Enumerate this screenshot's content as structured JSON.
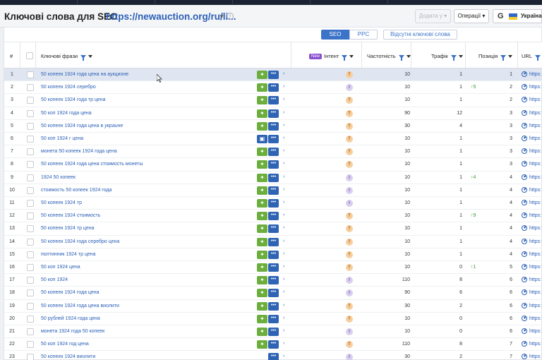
{
  "header": {
    "title": "Ключові слова для SEO",
    "domain": "https://newauction.org/ru/li...",
    "add_button": "Додати у",
    "operations_button": "Операції",
    "search_engine": "G",
    "country": "Україна"
  },
  "toggles": {
    "seo": "SEO",
    "ppc": "PPC",
    "missing": "Відсутні ключові слова"
  },
  "columns": {
    "num": "#",
    "keywords": "Ключові фрази",
    "intent_new": "New",
    "intent": "Інтент",
    "frequency": "Частотність",
    "traffic": "Трафік",
    "position": "Позиція",
    "url": "URL"
  },
  "colors": {
    "accent": "#3b73c8",
    "green_button": "#6cae3e",
    "blue_button": "#2f64b5",
    "intent_t": "#f6cfa0",
    "intent_i": "#d9cfee",
    "change_up": "#3c9a3c"
  },
  "rows": [
    {
      "num": "1",
      "kw": "50 копеек 1924 года цена на аукционе",
      "intent": "T",
      "freq": "10",
      "traffic": "1",
      "change": "",
      "pos": "1",
      "url": "https:"
    },
    {
      "num": "2",
      "kw": "50 копеек 1924 серебро",
      "intent": "I",
      "freq": "10",
      "traffic": "1",
      "change": "↑5",
      "pos": "2",
      "url": "https:"
    },
    {
      "num": "3",
      "kw": "50 копеек 1924 года тр цена",
      "intent": "T",
      "freq": "10",
      "traffic": "1",
      "change": "",
      "pos": "2",
      "url": "https:"
    },
    {
      "num": "4",
      "kw": "50 коп 1924 года цена",
      "intent": "T",
      "freq": "90",
      "traffic": "12",
      "change": "",
      "pos": "3",
      "url": "https:"
    },
    {
      "num": "5",
      "kw": "50 копеек 1924 года цена в украине",
      "intent": "T",
      "freq": "30",
      "traffic": "4",
      "change": "",
      "pos": "3",
      "url": "https:"
    },
    {
      "num": "6",
      "kw": "50 коп 1924 г цена",
      "intent": "T",
      "freq": "10",
      "traffic": "1",
      "change": "",
      "pos": "3",
      "url": "https:"
    },
    {
      "num": "7",
      "kw": "монета 50 копеек 1924 года цена",
      "intent": "T",
      "freq": "10",
      "traffic": "1",
      "change": "",
      "pos": "3",
      "url": "https:"
    },
    {
      "num": "8",
      "kw": "50 копеек 1924 года цена стоимость монеты",
      "intent": "T",
      "freq": "10",
      "traffic": "1",
      "change": "",
      "pos": "3",
      "url": "https:"
    },
    {
      "num": "9",
      "kw": "1924 50 копеек",
      "intent": "I",
      "freq": "10",
      "traffic": "1",
      "change": "↑4",
      "pos": "4",
      "url": "https:"
    },
    {
      "num": "10",
      "kw": "стоимость 50 копеек 1924 года",
      "intent": "I",
      "freq": "10",
      "traffic": "1",
      "change": "",
      "pos": "4",
      "url": "https:"
    },
    {
      "num": "11",
      "kw": "50 копеек 1924 тр",
      "intent": "I",
      "freq": "10",
      "traffic": "1",
      "change": "",
      "pos": "4",
      "url": "https:"
    },
    {
      "num": "12",
      "kw": "50 копеек 1924 стоимость",
      "intent": "T",
      "freq": "10",
      "traffic": "1",
      "change": "↑9",
      "pos": "4",
      "url": "https:"
    },
    {
      "num": "13",
      "kw": "50 копеек 1924 тр цена",
      "intent": "T",
      "freq": "10",
      "traffic": "1",
      "change": "",
      "pos": "4",
      "url": "https:"
    },
    {
      "num": "14",
      "kw": "50 копеек 1924 года серебро цена",
      "intent": "T",
      "freq": "10",
      "traffic": "1",
      "change": "",
      "pos": "4",
      "url": "https:"
    },
    {
      "num": "15",
      "kw": "полтинник 1924 тр цена",
      "intent": "T",
      "freq": "10",
      "traffic": "1",
      "change": "",
      "pos": "4",
      "url": "https:"
    },
    {
      "num": "16",
      "kw": "50 коп 1924 цена",
      "intent": "T",
      "freq": "10",
      "traffic": "0",
      "change": "↑1",
      "pos": "5",
      "url": "https:"
    },
    {
      "num": "17",
      "kw": "50 коп 1924",
      "intent": "I",
      "freq": "110",
      "traffic": "8",
      "change": "",
      "pos": "6",
      "url": "https:"
    },
    {
      "num": "18",
      "kw": "50 копеек 1924 года цена",
      "intent": "I",
      "freq": "90",
      "traffic": "6",
      "change": "",
      "pos": "6",
      "url": "https:"
    },
    {
      "num": "19",
      "kw": "50 копеек 1924 года цена виолити",
      "intent": "T",
      "freq": "30",
      "traffic": "2",
      "change": "",
      "pos": "6",
      "url": "https:"
    },
    {
      "num": "20",
      "kw": "50 рублей 1924 года цена",
      "intent": "T",
      "freq": "10",
      "traffic": "0",
      "change": "",
      "pos": "6",
      "url": "https:"
    },
    {
      "num": "21",
      "kw": "монета 1924 года 50 копеек",
      "intent": "I",
      "freq": "10",
      "traffic": "0",
      "change": "",
      "pos": "6",
      "url": "https:"
    },
    {
      "num": "22",
      "kw": "50 коп 1924 год цена",
      "intent": "T",
      "freq": "110",
      "traffic": "8",
      "change": "",
      "pos": "7",
      "url": "https:"
    },
    {
      "num": "23",
      "kw": "50 копеек 1924 виолити",
      "intent": "I",
      "freq": "30",
      "traffic": "2",
      "change": "",
      "pos": "7",
      "url": "https:"
    }
  ]
}
